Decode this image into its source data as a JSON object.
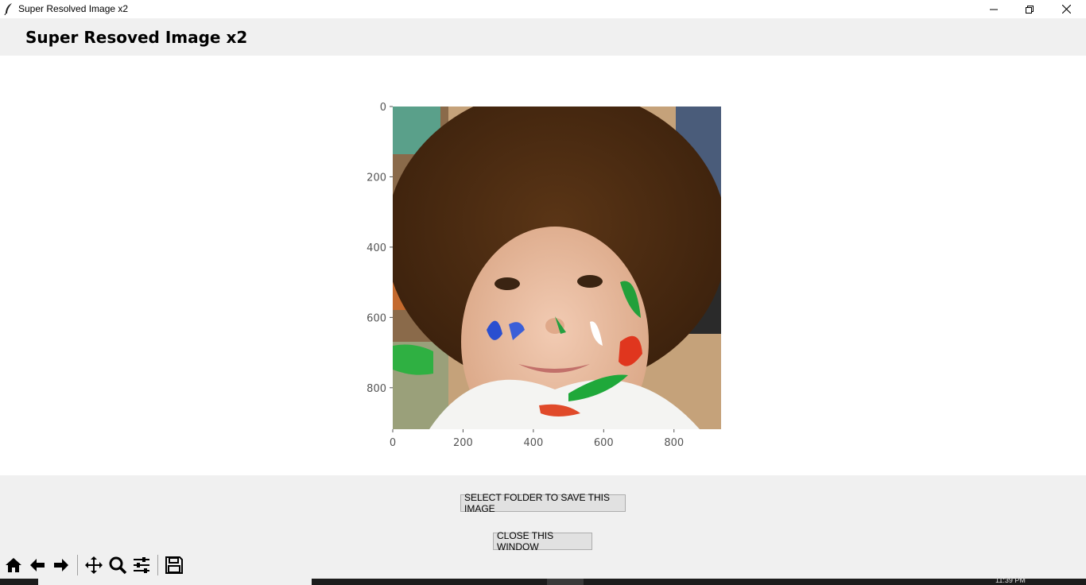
{
  "window": {
    "title": "Super Resolved Image x2",
    "controls": {
      "minimize": "minimize-icon",
      "maximize": "restore-icon",
      "close": "close-icon"
    }
  },
  "header": {
    "title": "Super Resoved Image x2"
  },
  "chart_data": {
    "type": "image",
    "x_ticks": [
      "0",
      "200",
      "400",
      "600",
      "800"
    ],
    "y_ticks": [
      "0",
      "200",
      "400",
      "600",
      "800"
    ],
    "x_tick_values": [
      0,
      200,
      400,
      600,
      800
    ],
    "y_tick_values": [
      0,
      200,
      400,
      600,
      800
    ],
    "xlim": [
      0,
      934
    ],
    "ylim": [
      918,
      0
    ],
    "image_subject": "photo of a smiling curly-haired child with paint on face"
  },
  "actions": {
    "save_label": "SELECT FOLDER TO SAVE THIS IMAGE",
    "close_label": "CLOSE THIS WINDOW"
  },
  "toolbar": {
    "icons": [
      "home-icon",
      "back-icon",
      "forward-icon",
      "pan-icon",
      "zoom-icon",
      "configure-subplots-icon",
      "save-icon"
    ]
  },
  "taskbar": {
    "clock": "11:39 PM"
  },
  "colors": {
    "window_bg": "#f0f0f0",
    "canvas_bg": "#ffffff",
    "button_bg": "#e1e1e1",
    "axis_text": "#555555"
  }
}
